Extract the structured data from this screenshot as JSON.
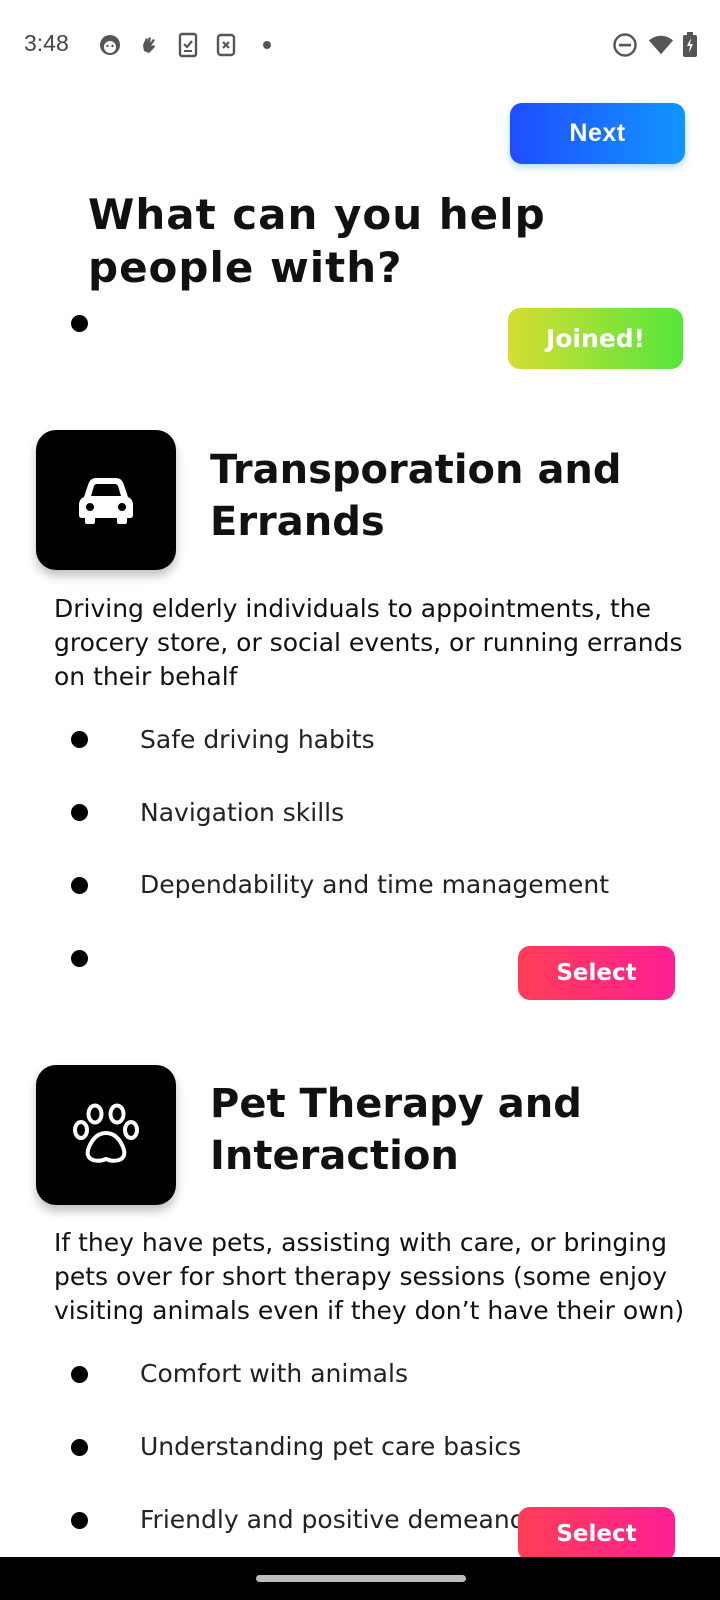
{
  "status_bar": {
    "time": "3:48",
    "left_icons": [
      "face-notification-icon",
      "hand-notification-icon",
      "clipboard-notification-icon",
      "cancel-doc-notification-icon",
      "dot-icon"
    ],
    "right_icons": [
      "do-not-disturb-icon",
      "wifi-icon",
      "battery-charging-icon"
    ]
  },
  "header": {
    "next_label": "Next",
    "title": "What can you help people with?",
    "joined_label": "Joined!"
  },
  "cards": [
    {
      "icon": "car-icon",
      "title": "Transporation and Errands",
      "description": "Driving elderly individuals to appointments, the grocery store, or social events, or running errands on their behalf",
      "skills": [
        "Safe driving habits",
        "Navigation skills",
        "Dependability and time management",
        ""
      ],
      "select_label": "Select"
    },
    {
      "icon": "paw-icon",
      "title": "Pet Therapy and Interaction",
      "description": "If they have pets, assisting with care, or bringing pets over for short therapy sessions (some enjoy visiting animals even if they don’t have their own)",
      "skills": [
        "Comfort with animals",
        "Understanding pet care basics",
        "Friendly and positive demeanor"
      ],
      "select_label": "Select"
    }
  ],
  "colors": {
    "next_gradient": [
      "#1f4dff",
      "#1296ff"
    ],
    "joined_gradient": [
      "#d6dd33",
      "#55e63a"
    ],
    "select_gradient": [
      "#ff3e55",
      "#ff1f95"
    ]
  }
}
